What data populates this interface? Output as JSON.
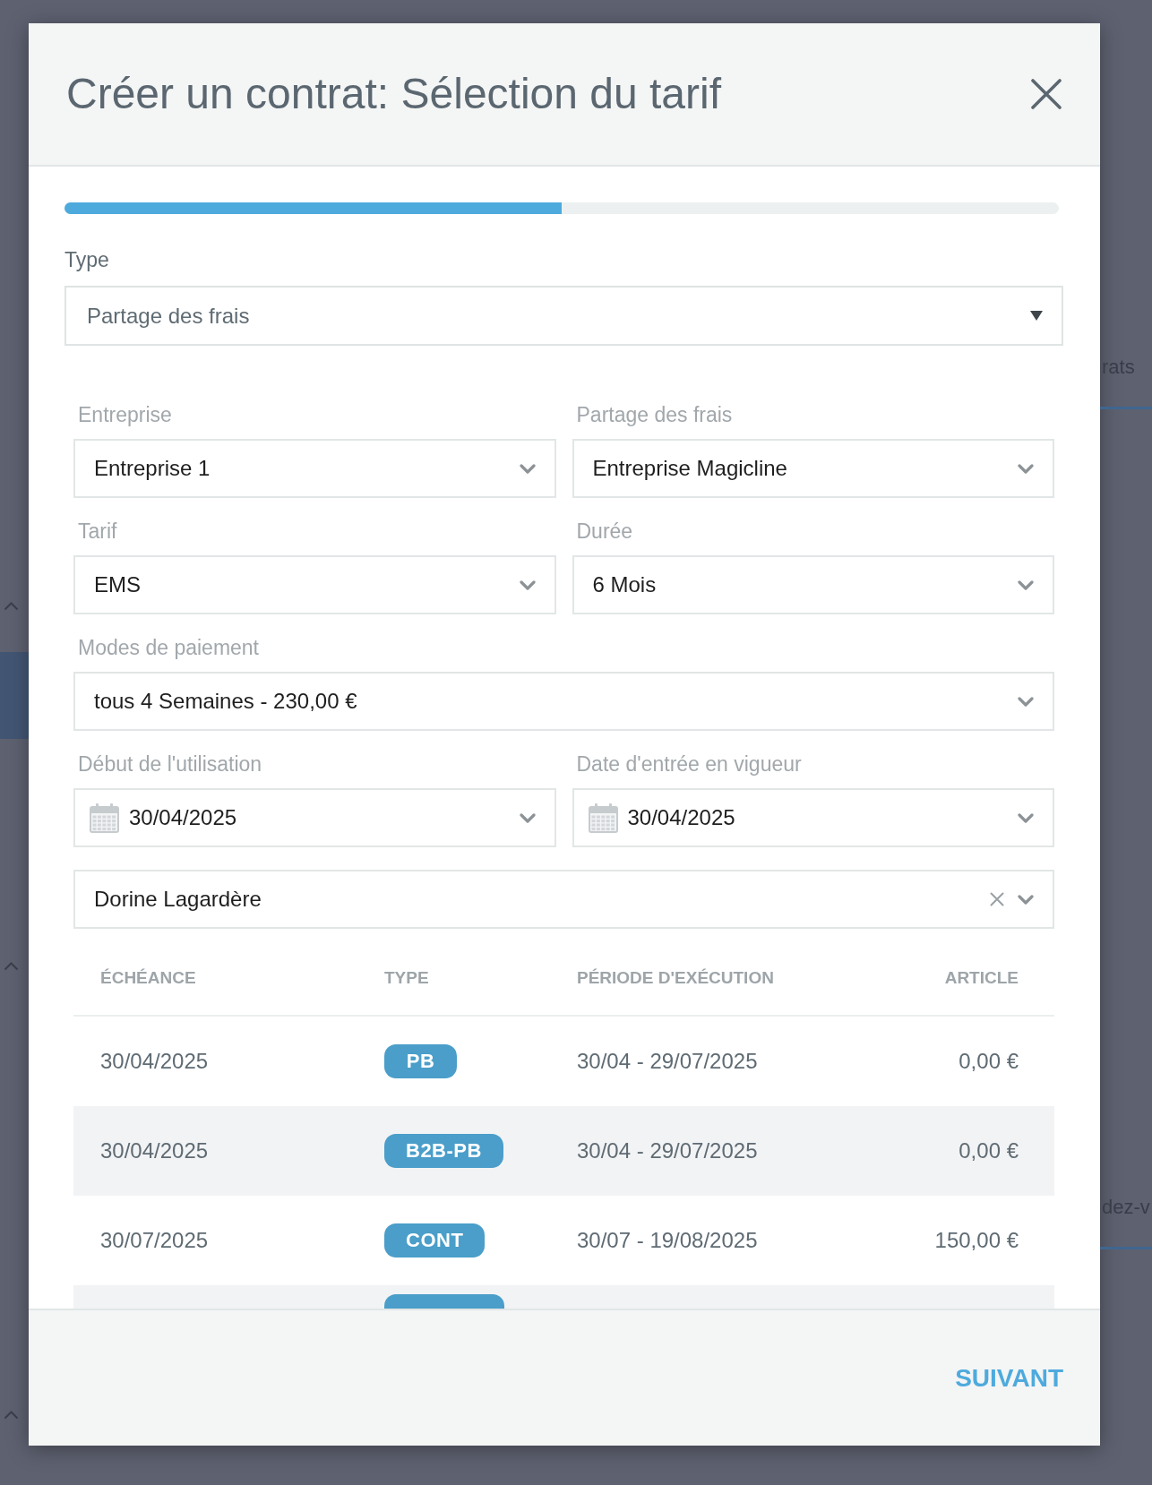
{
  "backdrop": {
    "tabs": [
      {
        "label": "rats"
      },
      {
        "label": "dez-v"
      }
    ]
  },
  "dialog": {
    "title": "Créer un contrat: Sélection du tarif",
    "progress": {
      "level": 0.5
    },
    "type_field": {
      "label": "Type",
      "value": "Partage des frais"
    },
    "fields": [
      {
        "kind": "select",
        "label": "Entreprise",
        "value": "Entreprise 1",
        "wide": false
      },
      {
        "kind": "select",
        "label": "Partage des frais",
        "value": "Entreprise Magicline",
        "wide": false
      },
      {
        "kind": "select",
        "label": "Tarif",
        "value": "EMS",
        "wide": false
      },
      {
        "kind": "select",
        "label": "Durée",
        "value": "6 Mois",
        "wide": false
      },
      {
        "kind": "select",
        "label": "Modes de paiement",
        "value": "tous 4 Semaines - 230,00 €",
        "wide": true
      },
      {
        "kind": "date",
        "label": "Début de l'utilisation",
        "value": "30/04/2025",
        "wide": false
      },
      {
        "kind": "date",
        "label": "Date d'entrée en vigueur",
        "value": "30/04/2025",
        "wide": false
      },
      {
        "kind": "clearable",
        "value": "Dorine Lagardère",
        "wide": true
      }
    ],
    "table": {
      "columns": [
        "ÉCHÉANCE",
        "TYPE",
        "PÉRIODE D'EXÉCUTION",
        "ARTICLE"
      ],
      "rows": [
        {
          "due": "30/04/2025",
          "type": "PB",
          "period": "30/04 - 29/07/2025",
          "amount": "0,00 €"
        },
        {
          "due": "30/04/2025",
          "type": "B2B-PB",
          "period": "30/04 - 29/07/2025",
          "amount": "0,00 €"
        },
        {
          "due": "30/07/2025",
          "type": "CONT",
          "period": "30/07 - 19/08/2025",
          "amount": "150,00 €"
        }
      ],
      "more_rows_below": true
    },
    "next_button": "SUIVANT"
  }
}
